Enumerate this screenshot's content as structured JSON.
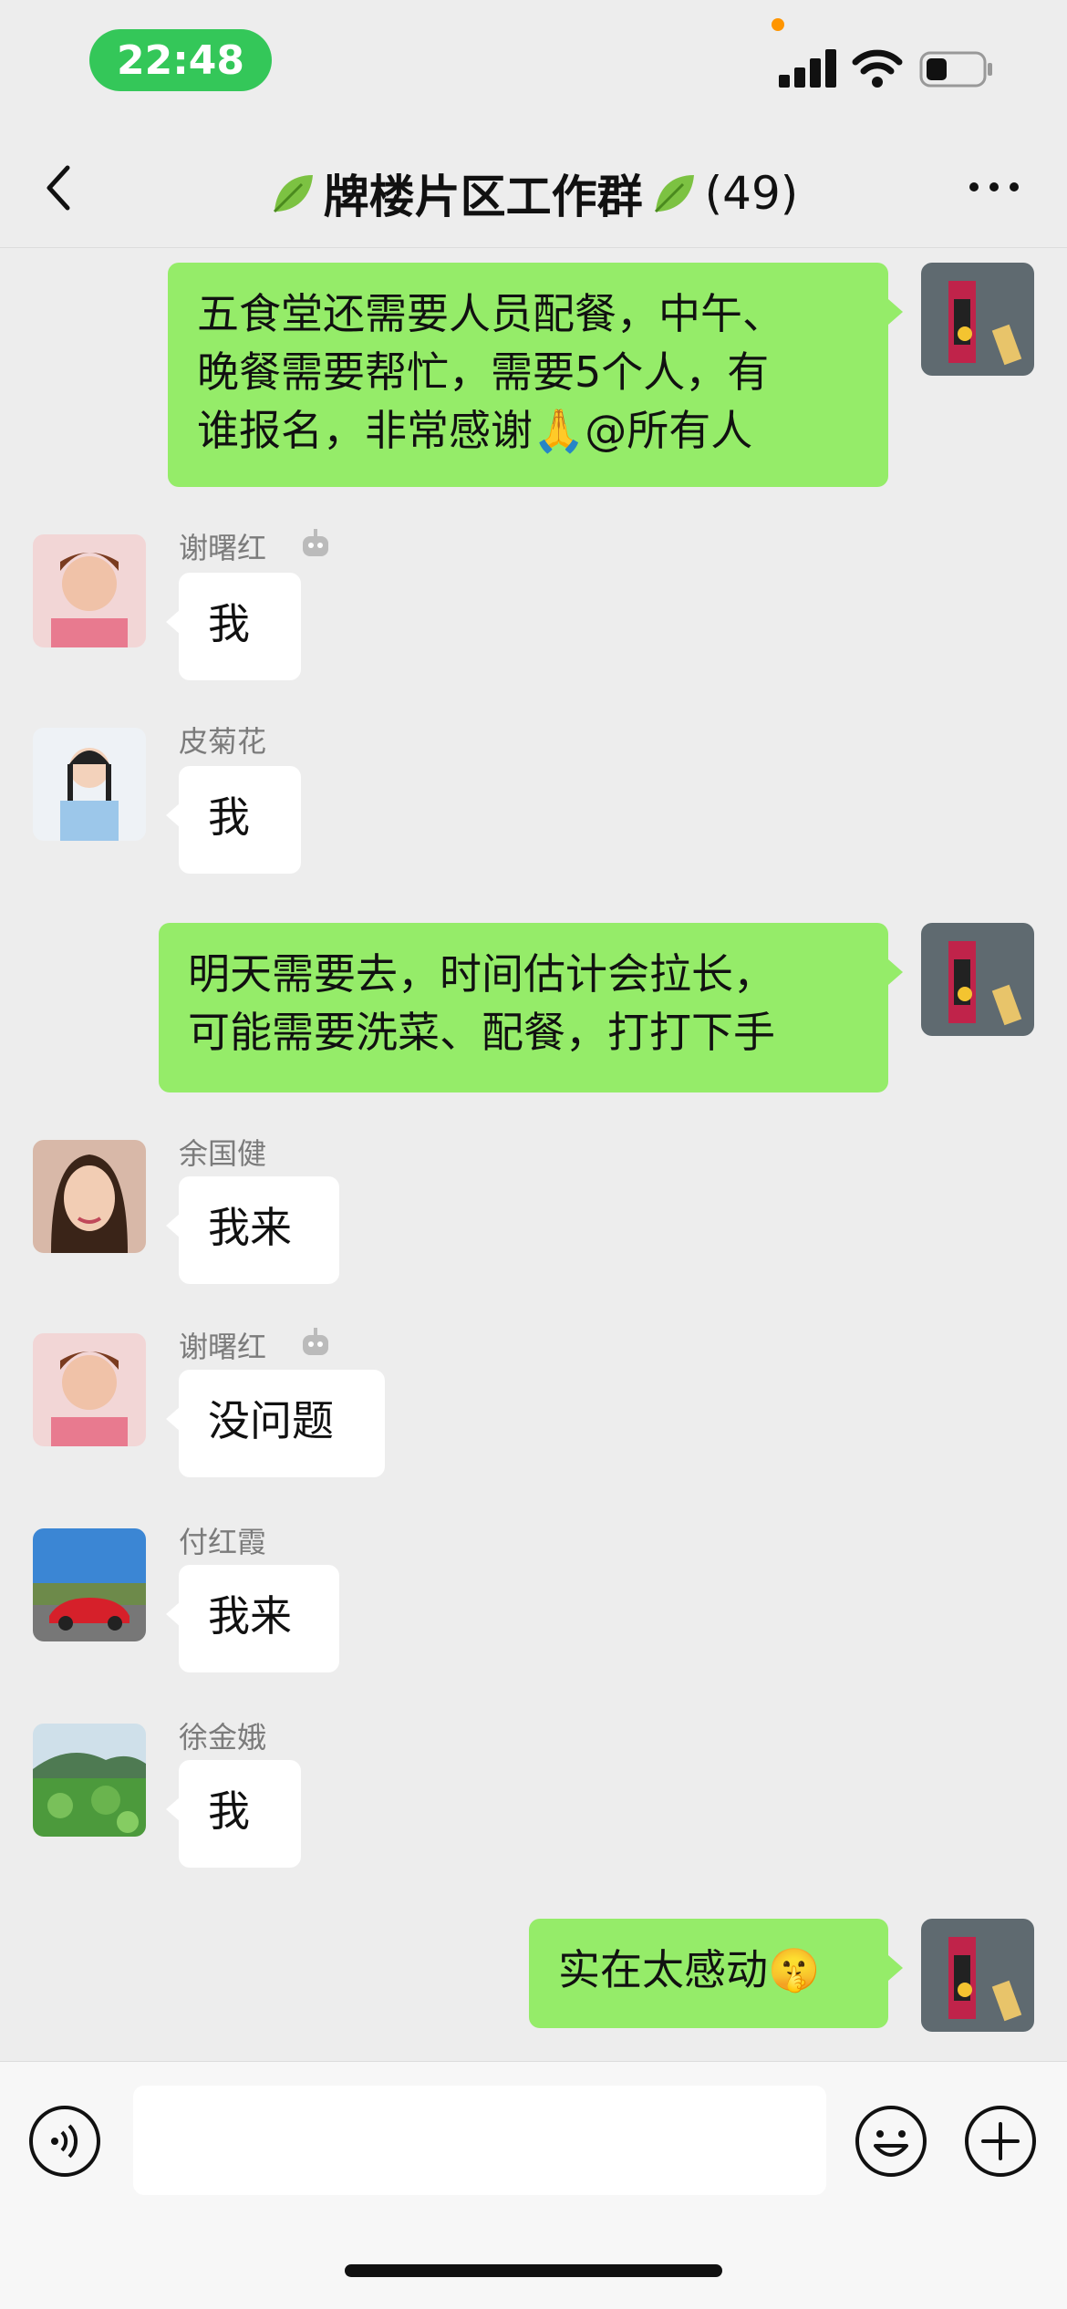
{
  "status_bar": {
    "time": "22:48",
    "accent_color": "#34c759",
    "battery_icon": "battery-icon",
    "wifi_icon": "wifi-icon",
    "signal_icon": "signal-icon"
  },
  "nav": {
    "title": "牌楼片区工作群",
    "member_count": "(49)",
    "back_icon": "chevron-left-icon",
    "more_icon": "more-dots-icon"
  },
  "messages": [
    {
      "side": "right",
      "text": "五食堂还需要人员配餐，中午、\n晚餐需要帮忙，需要5个人，有\n谁报名，非常感谢🙏@所有人"
    },
    {
      "side": "left",
      "sender": "谢曙红",
      "text": "我"
    },
    {
      "side": "left",
      "sender": "皮菊花",
      "text": "我"
    },
    {
      "side": "right",
      "text": "明天需要去，时间估计会拉长，\n可能需要洗菜、配餐，打打下手"
    },
    {
      "side": "left",
      "sender": "余国健",
      "text": "我来"
    },
    {
      "side": "left",
      "sender": "谢曙红",
      "text": "没问题"
    },
    {
      "side": "left",
      "sender": "付红霞",
      "text": "我来"
    },
    {
      "side": "left",
      "sender": "徐金娥",
      "text": "我"
    },
    {
      "side": "right",
      "text": "实在太感动🤫"
    }
  ],
  "input_bar": {
    "placeholder": "",
    "voice_icon": "voice-icon",
    "emoji_icon": "emoji-icon",
    "plus_icon": "plus-icon"
  },
  "colors": {
    "background": "#ededed",
    "my_bubble": "#95ec69",
    "other_bubble": "#ffffff"
  }
}
